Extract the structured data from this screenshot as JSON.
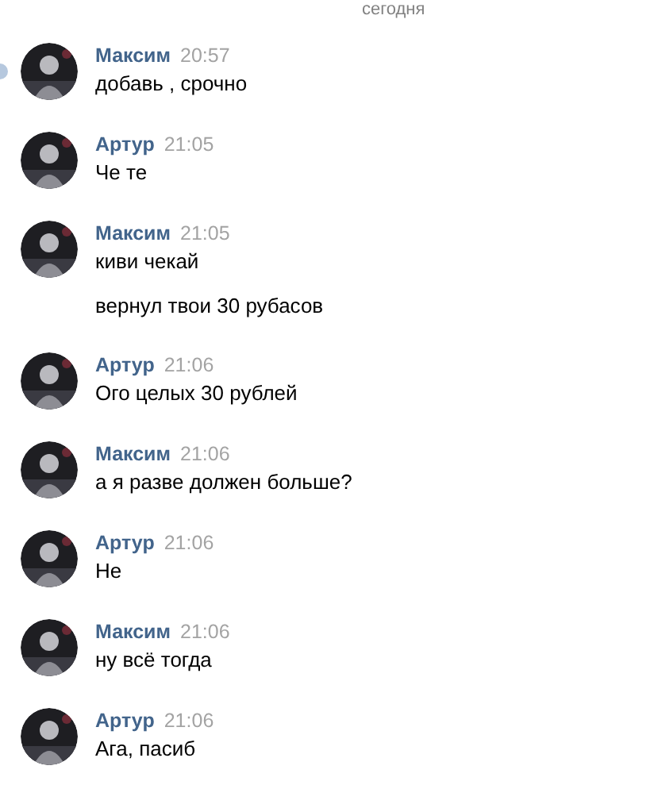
{
  "date_divider": "сегодня",
  "messages": [
    {
      "author": "Максим",
      "time": "20:57",
      "unread": true,
      "paragraphs": [
        "добавь , срочно"
      ]
    },
    {
      "author": "Артур",
      "time": "21:05",
      "unread": false,
      "paragraphs": [
        "Че те"
      ]
    },
    {
      "author": "Максим",
      "time": "21:05",
      "unread": false,
      "paragraphs": [
        "киви чекай",
        "вернул твои 30 рубасов"
      ]
    },
    {
      "author": "Артур",
      "time": "21:06",
      "unread": false,
      "paragraphs": [
        "Ого целых 30 рублей"
      ]
    },
    {
      "author": "Максим",
      "time": "21:06",
      "unread": false,
      "paragraphs": [
        "а я разве должен больше?"
      ]
    },
    {
      "author": "Артур",
      "time": "21:06",
      "unread": false,
      "paragraphs": [
        "Не"
      ]
    },
    {
      "author": "Максим",
      "time": "21:06",
      "unread": false,
      "paragraphs": [
        "ну всё тогда"
      ]
    },
    {
      "author": "Артур",
      "time": "21:06",
      "unread": false,
      "paragraphs": [
        "Ага, пасиб"
      ]
    }
  ]
}
